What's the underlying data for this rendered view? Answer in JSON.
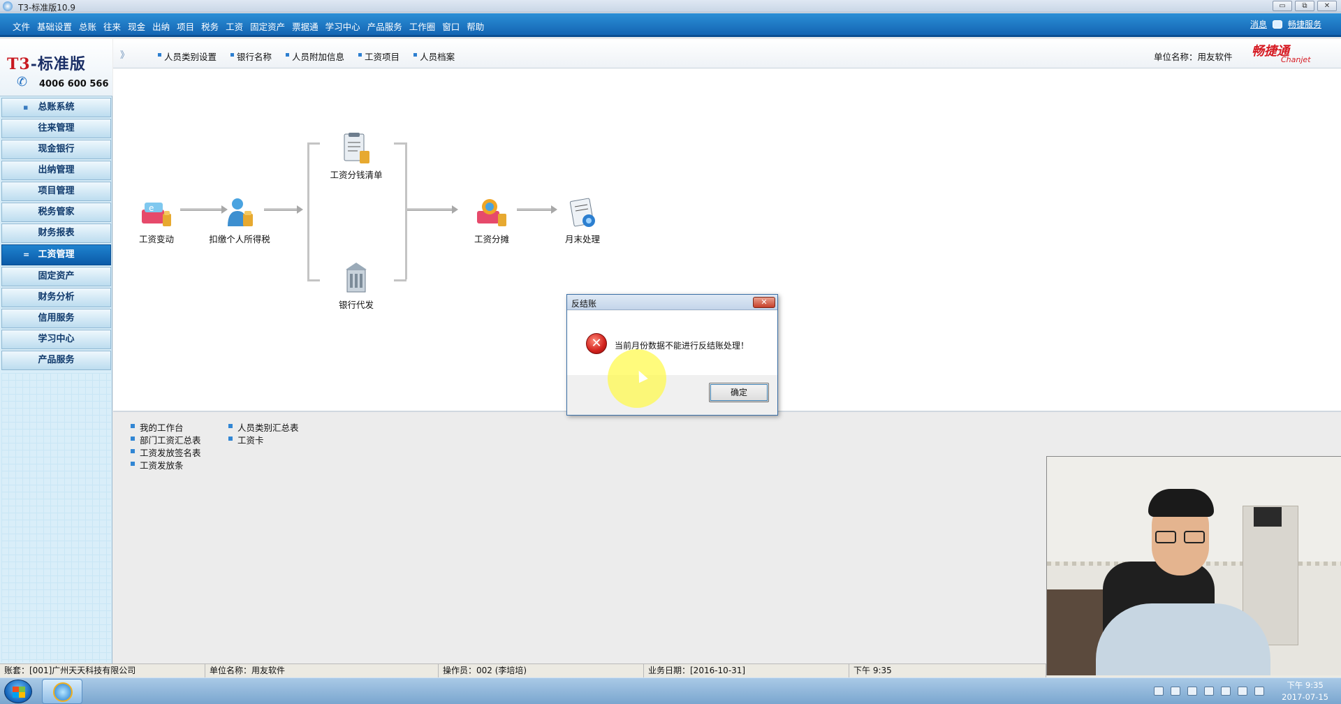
{
  "window": {
    "title": "T3-标准版10.9",
    "controls": [
      "▭",
      "⧉",
      "✕"
    ]
  },
  "menubar": {
    "items": [
      "文件",
      "基础设置",
      "总账",
      "往来",
      "现金",
      "出纳",
      "项目",
      "税务",
      "工资",
      "固定资产",
      "票据通",
      "学习中心",
      "产品服务",
      "工作圈",
      "窗口",
      "帮助"
    ],
    "message": "消息",
    "service": "畅捷服务"
  },
  "brand": {
    "logo_t3": "T3",
    "logo_rest": "-标准版",
    "phone": "4006 600 566"
  },
  "sidebar": {
    "items": [
      {
        "label": "总账系统",
        "bullet": "▪"
      },
      {
        "label": "往来管理",
        "bullet": ""
      },
      {
        "label": "现金银行",
        "bullet": ""
      },
      {
        "label": "出纳管理",
        "bullet": ""
      },
      {
        "label": "项目管理",
        "bullet": ""
      },
      {
        "label": "税务管家",
        "bullet": ""
      },
      {
        "label": "财务报表",
        "bullet": ""
      },
      {
        "label": "工资管理",
        "bullet": "="
      },
      {
        "label": "固定资产",
        "bullet": ""
      },
      {
        "label": "财务分析",
        "bullet": ""
      },
      {
        "label": "信用服务",
        "bullet": ""
      },
      {
        "label": "学习中心",
        "bullet": ""
      },
      {
        "label": "产品服务",
        "bullet": ""
      }
    ],
    "active_index": 7
  },
  "toolbar": {
    "chevron": "》",
    "tools": [
      "人员类别设置",
      "银行名称",
      "人员附加信息",
      "工资项目",
      "人员档案"
    ],
    "unit_name": "单位名称：用友软件",
    "brand_cn": "畅捷通",
    "brand_en": "Chanjet"
  },
  "workflow": {
    "nodes": {
      "wage_change": "工资变动",
      "tax": "扣缴个人所得税",
      "cash_list": "工资分钱清单",
      "bank": "银行代发",
      "allocation": "工资分摊",
      "month_end": "月末处理"
    }
  },
  "reports": {
    "col1": [
      "我的工作台",
      "部门工资汇总表",
      "工资发放签名表",
      "工资发放条"
    ],
    "col2": [
      "人员类别汇总表",
      "工资卡"
    ]
  },
  "statusbar": {
    "account": "账套：[001]广州天天科技有限公司",
    "unit": "单位名称：用友软件",
    "operator": "操作员：002 (李培培)",
    "business_date": "业务日期：[2016-10-31]",
    "time": "下午 9:35"
  },
  "dialog": {
    "title": "反结账",
    "close": "✕",
    "message": "当前月份数据不能进行反结账处理！",
    "ok_label": "确定",
    "error_glyph": "✕"
  },
  "taskbar": {
    "time": "下午 9:35",
    "date": "2017-07-15"
  },
  "colors": {
    "menubar": "#1a74c3",
    "sidebar": "#d9eef9",
    "active_nav": "#1466b4",
    "error": "#d1211c",
    "brand_red": "#d61a22"
  }
}
